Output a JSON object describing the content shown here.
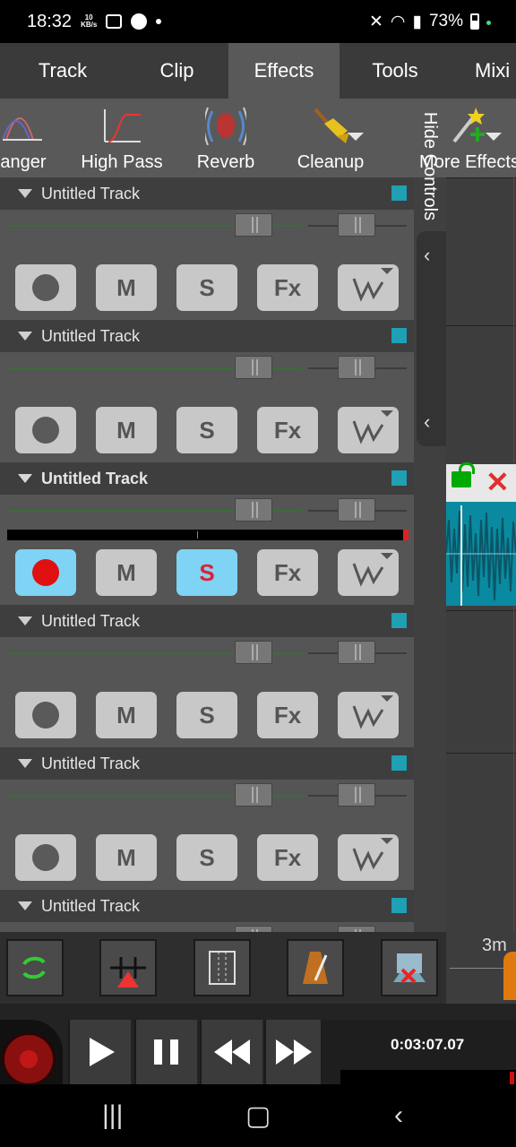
{
  "status_bar": {
    "time": "18:32",
    "speed_value": "10",
    "speed_unit": "KB/s",
    "battery": "73%"
  },
  "tabs": [
    {
      "label": "Track",
      "active": false
    },
    {
      "label": "Clip",
      "active": false
    },
    {
      "label": "Effects",
      "active": true
    },
    {
      "label": "Tools",
      "active": false
    },
    {
      "label": "Mixi",
      "active": false
    }
  ],
  "effects_toolbar": {
    "items": [
      {
        "label": "anger",
        "icon": "flanger-icon"
      },
      {
        "label": "High Pass",
        "icon": "high-pass-icon"
      },
      {
        "label": "Reverb",
        "icon": "reverb-icon"
      },
      {
        "label": "Cleanup",
        "icon": "broom-icon"
      },
      {
        "label": "More Effects",
        "icon": "magic-wand-icon"
      }
    ]
  },
  "tracks": [
    {
      "name": "Untitled Track",
      "selected": false,
      "armed": false,
      "solo": false,
      "color": "#1fa0b4"
    },
    {
      "name": "Untitled Track",
      "selected": false,
      "armed": false,
      "solo": false,
      "color": "#1fa0b4"
    },
    {
      "name": "Untitled Track",
      "selected": true,
      "armed": true,
      "solo": true,
      "color": "#1fa0b4"
    },
    {
      "name": "Untitled Track",
      "selected": false,
      "armed": false,
      "solo": false,
      "color": "#1fa0b4"
    },
    {
      "name": "Untitled Track",
      "selected": false,
      "armed": false,
      "solo": false,
      "color": "#1fa0b4"
    },
    {
      "name": "Untitled Track",
      "selected": false,
      "armed": false,
      "solo": false,
      "color": "#1fa0b4"
    }
  ],
  "track_buttons": {
    "mute": "M",
    "solo": "S",
    "fx": "Fx"
  },
  "hide_controls": "Hide Controls",
  "ruler": {
    "label": "3m"
  },
  "transport": {
    "time": "0:03:07.07"
  }
}
